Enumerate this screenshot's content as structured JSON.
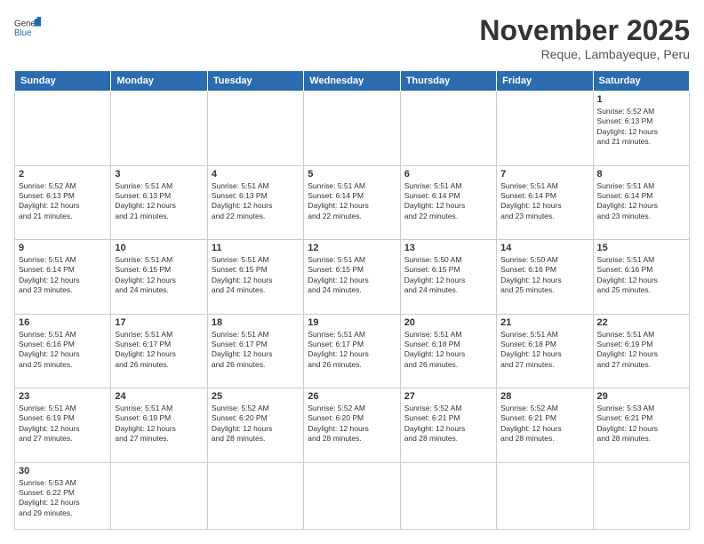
{
  "header": {
    "logo_general": "General",
    "logo_blue": "Blue",
    "month_title": "November 2025",
    "location": "Reque, Lambayeque, Peru"
  },
  "weekdays": [
    "Sunday",
    "Monday",
    "Tuesday",
    "Wednesday",
    "Thursday",
    "Friday",
    "Saturday"
  ],
  "weeks": [
    [
      {
        "day": "",
        "info": ""
      },
      {
        "day": "",
        "info": ""
      },
      {
        "day": "",
        "info": ""
      },
      {
        "day": "",
        "info": ""
      },
      {
        "day": "",
        "info": ""
      },
      {
        "day": "",
        "info": ""
      },
      {
        "day": "1",
        "info": "Sunrise: 5:52 AM\nSunset: 6:13 PM\nDaylight: 12 hours\nand 21 minutes."
      }
    ],
    [
      {
        "day": "2",
        "info": "Sunrise: 5:52 AM\nSunset: 6:13 PM\nDaylight: 12 hours\nand 21 minutes."
      },
      {
        "day": "3",
        "info": "Sunrise: 5:51 AM\nSunset: 6:13 PM\nDaylight: 12 hours\nand 21 minutes."
      },
      {
        "day": "4",
        "info": "Sunrise: 5:51 AM\nSunset: 6:13 PM\nDaylight: 12 hours\nand 22 minutes."
      },
      {
        "day": "5",
        "info": "Sunrise: 5:51 AM\nSunset: 6:14 PM\nDaylight: 12 hours\nand 22 minutes."
      },
      {
        "day": "6",
        "info": "Sunrise: 5:51 AM\nSunset: 6:14 PM\nDaylight: 12 hours\nand 22 minutes."
      },
      {
        "day": "7",
        "info": "Sunrise: 5:51 AM\nSunset: 6:14 PM\nDaylight: 12 hours\nand 23 minutes."
      },
      {
        "day": "8",
        "info": "Sunrise: 5:51 AM\nSunset: 6:14 PM\nDaylight: 12 hours\nand 23 minutes."
      }
    ],
    [
      {
        "day": "9",
        "info": "Sunrise: 5:51 AM\nSunset: 6:14 PM\nDaylight: 12 hours\nand 23 minutes."
      },
      {
        "day": "10",
        "info": "Sunrise: 5:51 AM\nSunset: 6:15 PM\nDaylight: 12 hours\nand 24 minutes."
      },
      {
        "day": "11",
        "info": "Sunrise: 5:51 AM\nSunset: 6:15 PM\nDaylight: 12 hours\nand 24 minutes."
      },
      {
        "day": "12",
        "info": "Sunrise: 5:51 AM\nSunset: 6:15 PM\nDaylight: 12 hours\nand 24 minutes."
      },
      {
        "day": "13",
        "info": "Sunrise: 5:50 AM\nSunset: 6:15 PM\nDaylight: 12 hours\nand 24 minutes."
      },
      {
        "day": "14",
        "info": "Sunrise: 5:50 AM\nSunset: 6:16 PM\nDaylight: 12 hours\nand 25 minutes."
      },
      {
        "day": "15",
        "info": "Sunrise: 5:51 AM\nSunset: 6:16 PM\nDaylight: 12 hours\nand 25 minutes."
      }
    ],
    [
      {
        "day": "16",
        "info": "Sunrise: 5:51 AM\nSunset: 6:16 PM\nDaylight: 12 hours\nand 25 minutes."
      },
      {
        "day": "17",
        "info": "Sunrise: 5:51 AM\nSunset: 6:17 PM\nDaylight: 12 hours\nand 26 minutes."
      },
      {
        "day": "18",
        "info": "Sunrise: 5:51 AM\nSunset: 6:17 PM\nDaylight: 12 hours\nand 26 minutes."
      },
      {
        "day": "19",
        "info": "Sunrise: 5:51 AM\nSunset: 6:17 PM\nDaylight: 12 hours\nand 26 minutes."
      },
      {
        "day": "20",
        "info": "Sunrise: 5:51 AM\nSunset: 6:18 PM\nDaylight: 12 hours\nand 26 minutes."
      },
      {
        "day": "21",
        "info": "Sunrise: 5:51 AM\nSunset: 6:18 PM\nDaylight: 12 hours\nand 27 minutes."
      },
      {
        "day": "22",
        "info": "Sunrise: 5:51 AM\nSunset: 6:19 PM\nDaylight: 12 hours\nand 27 minutes."
      }
    ],
    [
      {
        "day": "23",
        "info": "Sunrise: 5:51 AM\nSunset: 6:19 PM\nDaylight: 12 hours\nand 27 minutes."
      },
      {
        "day": "24",
        "info": "Sunrise: 5:51 AM\nSunset: 6:19 PM\nDaylight: 12 hours\nand 27 minutes."
      },
      {
        "day": "25",
        "info": "Sunrise: 5:52 AM\nSunset: 6:20 PM\nDaylight: 12 hours\nand 28 minutes."
      },
      {
        "day": "26",
        "info": "Sunrise: 5:52 AM\nSunset: 6:20 PM\nDaylight: 12 hours\nand 28 minutes."
      },
      {
        "day": "27",
        "info": "Sunrise: 5:52 AM\nSunset: 6:21 PM\nDaylight: 12 hours\nand 28 minutes."
      },
      {
        "day": "28",
        "info": "Sunrise: 5:52 AM\nSunset: 6:21 PM\nDaylight: 12 hours\nand 28 minutes."
      },
      {
        "day": "29",
        "info": "Sunrise: 5:53 AM\nSunset: 6:21 PM\nDaylight: 12 hours\nand 28 minutes."
      }
    ],
    [
      {
        "day": "30",
        "info": "Sunrise: 5:53 AM\nSunset: 6:22 PM\nDaylight: 12 hours\nand 29 minutes."
      },
      {
        "day": "",
        "info": ""
      },
      {
        "day": "",
        "info": ""
      },
      {
        "day": "",
        "info": ""
      },
      {
        "day": "",
        "info": ""
      },
      {
        "day": "",
        "info": ""
      },
      {
        "day": "",
        "info": ""
      }
    ]
  ]
}
